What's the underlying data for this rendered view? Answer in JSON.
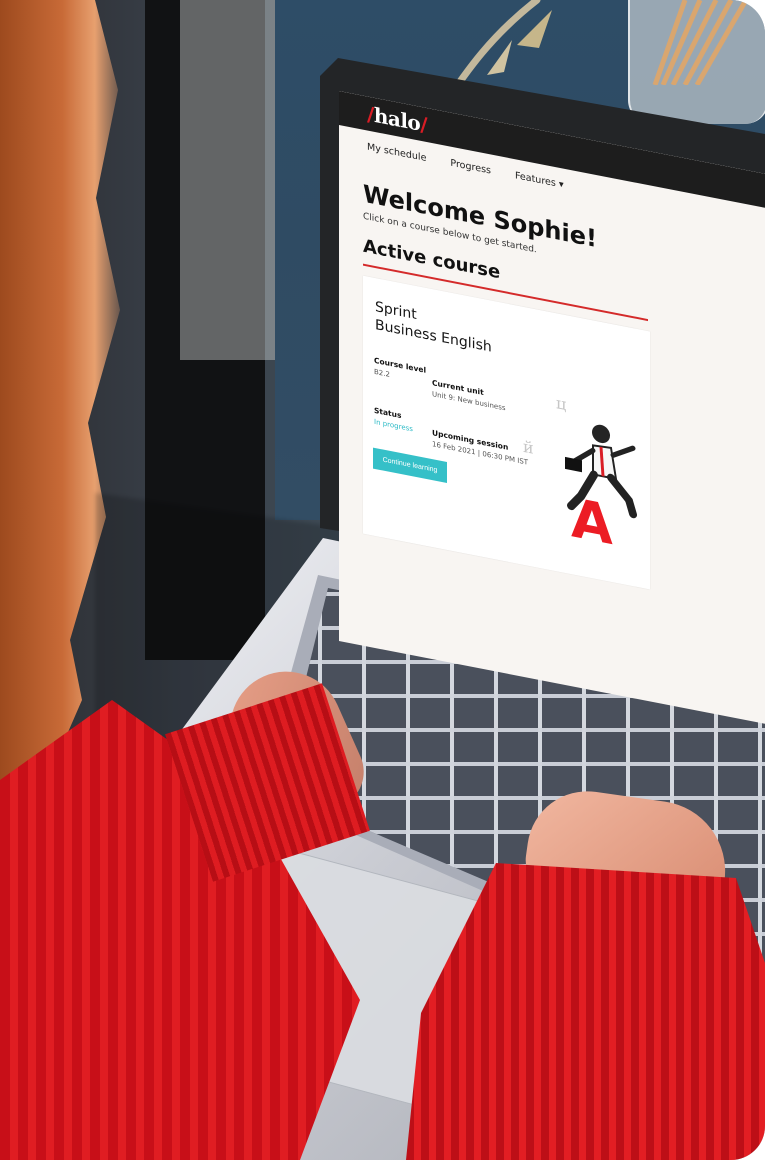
{
  "image": {
    "scene": "photo",
    "colors": {
      "accent_red": "#d91d25",
      "accent_teal": "#35c0c8",
      "sweater_red": "#d51820"
    }
  },
  "screen": {
    "logo": {
      "prefix": "/",
      "text": "halo",
      "suffix": "/"
    },
    "nav": {
      "items": [
        "My schedule",
        "Progress",
        "Features ▾"
      ]
    },
    "heading": "Welcome Sophie!",
    "subtitle": "Click on a course below to get started.",
    "section_title": "Active course",
    "course": {
      "name_lines": [
        "Sprint",
        "Business English"
      ],
      "level_label": "Course level",
      "level_value": "B2.2",
      "current_unit_label": "Current unit",
      "current_unit_value": "Unit 9: New business",
      "status_label": "Status",
      "status_value": "In progress",
      "upcoming_session_label": "Upcoming session",
      "upcoming_session_value": "16 Feb 2021 | 06:30 PM IST",
      "button_label": "Continue learning",
      "illustration_letter": "A",
      "illustration_glyphs": [
        "ц",
        "й"
      ]
    }
  }
}
